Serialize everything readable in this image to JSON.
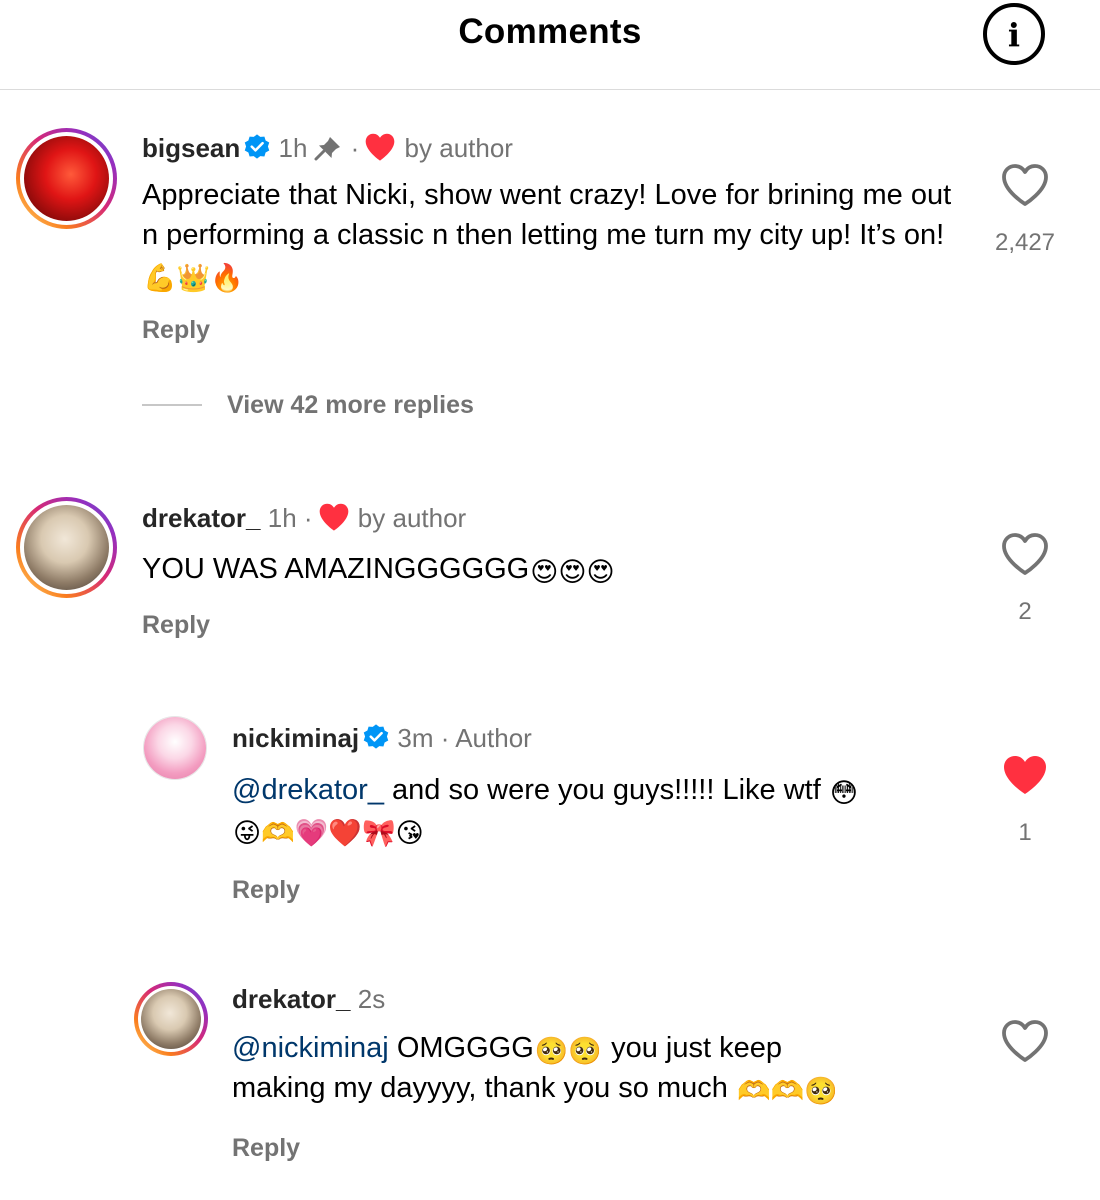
{
  "header": {
    "title": "Comments",
    "info_icon": "i"
  },
  "colors": {
    "like_red": "#ff3040",
    "verified_blue": "#0095f6",
    "mention_blue": "#00376b",
    "secondary_gray": "#737373"
  },
  "comments": [
    {
      "username": "bigsean",
      "verified": true,
      "time": "1h",
      "pinned": true,
      "dot": "·",
      "by_author": "by author",
      "text": "Appreciate that Nicki, show went crazy! Love for brining me out n performing a classic n then letting me turn my city up! It’s on!",
      "emojis": "💪👑🔥",
      "reply_label": "Reply",
      "like_count": "2,427",
      "liked": false,
      "view_replies": "View 42 more replies"
    },
    {
      "username": "drekator_",
      "verified": false,
      "time": "1h",
      "dot": "·",
      "by_author": "by author",
      "text": "YOU WAS AMAZINGGGGGG",
      "emojis": "😍😍😍",
      "reply_label": "Reply",
      "like_count": "2",
      "liked": false
    }
  ],
  "replies": [
    {
      "username": "nickiminaj",
      "verified": true,
      "time": "3m",
      "dot": "·",
      "author_label": "Author",
      "mention": "@drekator_",
      "text": " and so were you guys!!!!! Like wtf",
      "emoji_end": "😳",
      "emojis_line2": "😜🫶💗❤️🎀😘",
      "reply_label": "Reply",
      "like_count": "1",
      "liked": true
    },
    {
      "username": "drekator_",
      "verified": false,
      "time": "2s",
      "mention": "@nickiminaj",
      "text_a": " OMGGGG",
      "emojis_a": "🥺🥺",
      "text_b": " you just keep",
      "text_line2": "making my dayyyy, thank you so much",
      "emojis_line2": "🫶🫶🥺",
      "reply_label": "Reply",
      "liked": false
    }
  ]
}
